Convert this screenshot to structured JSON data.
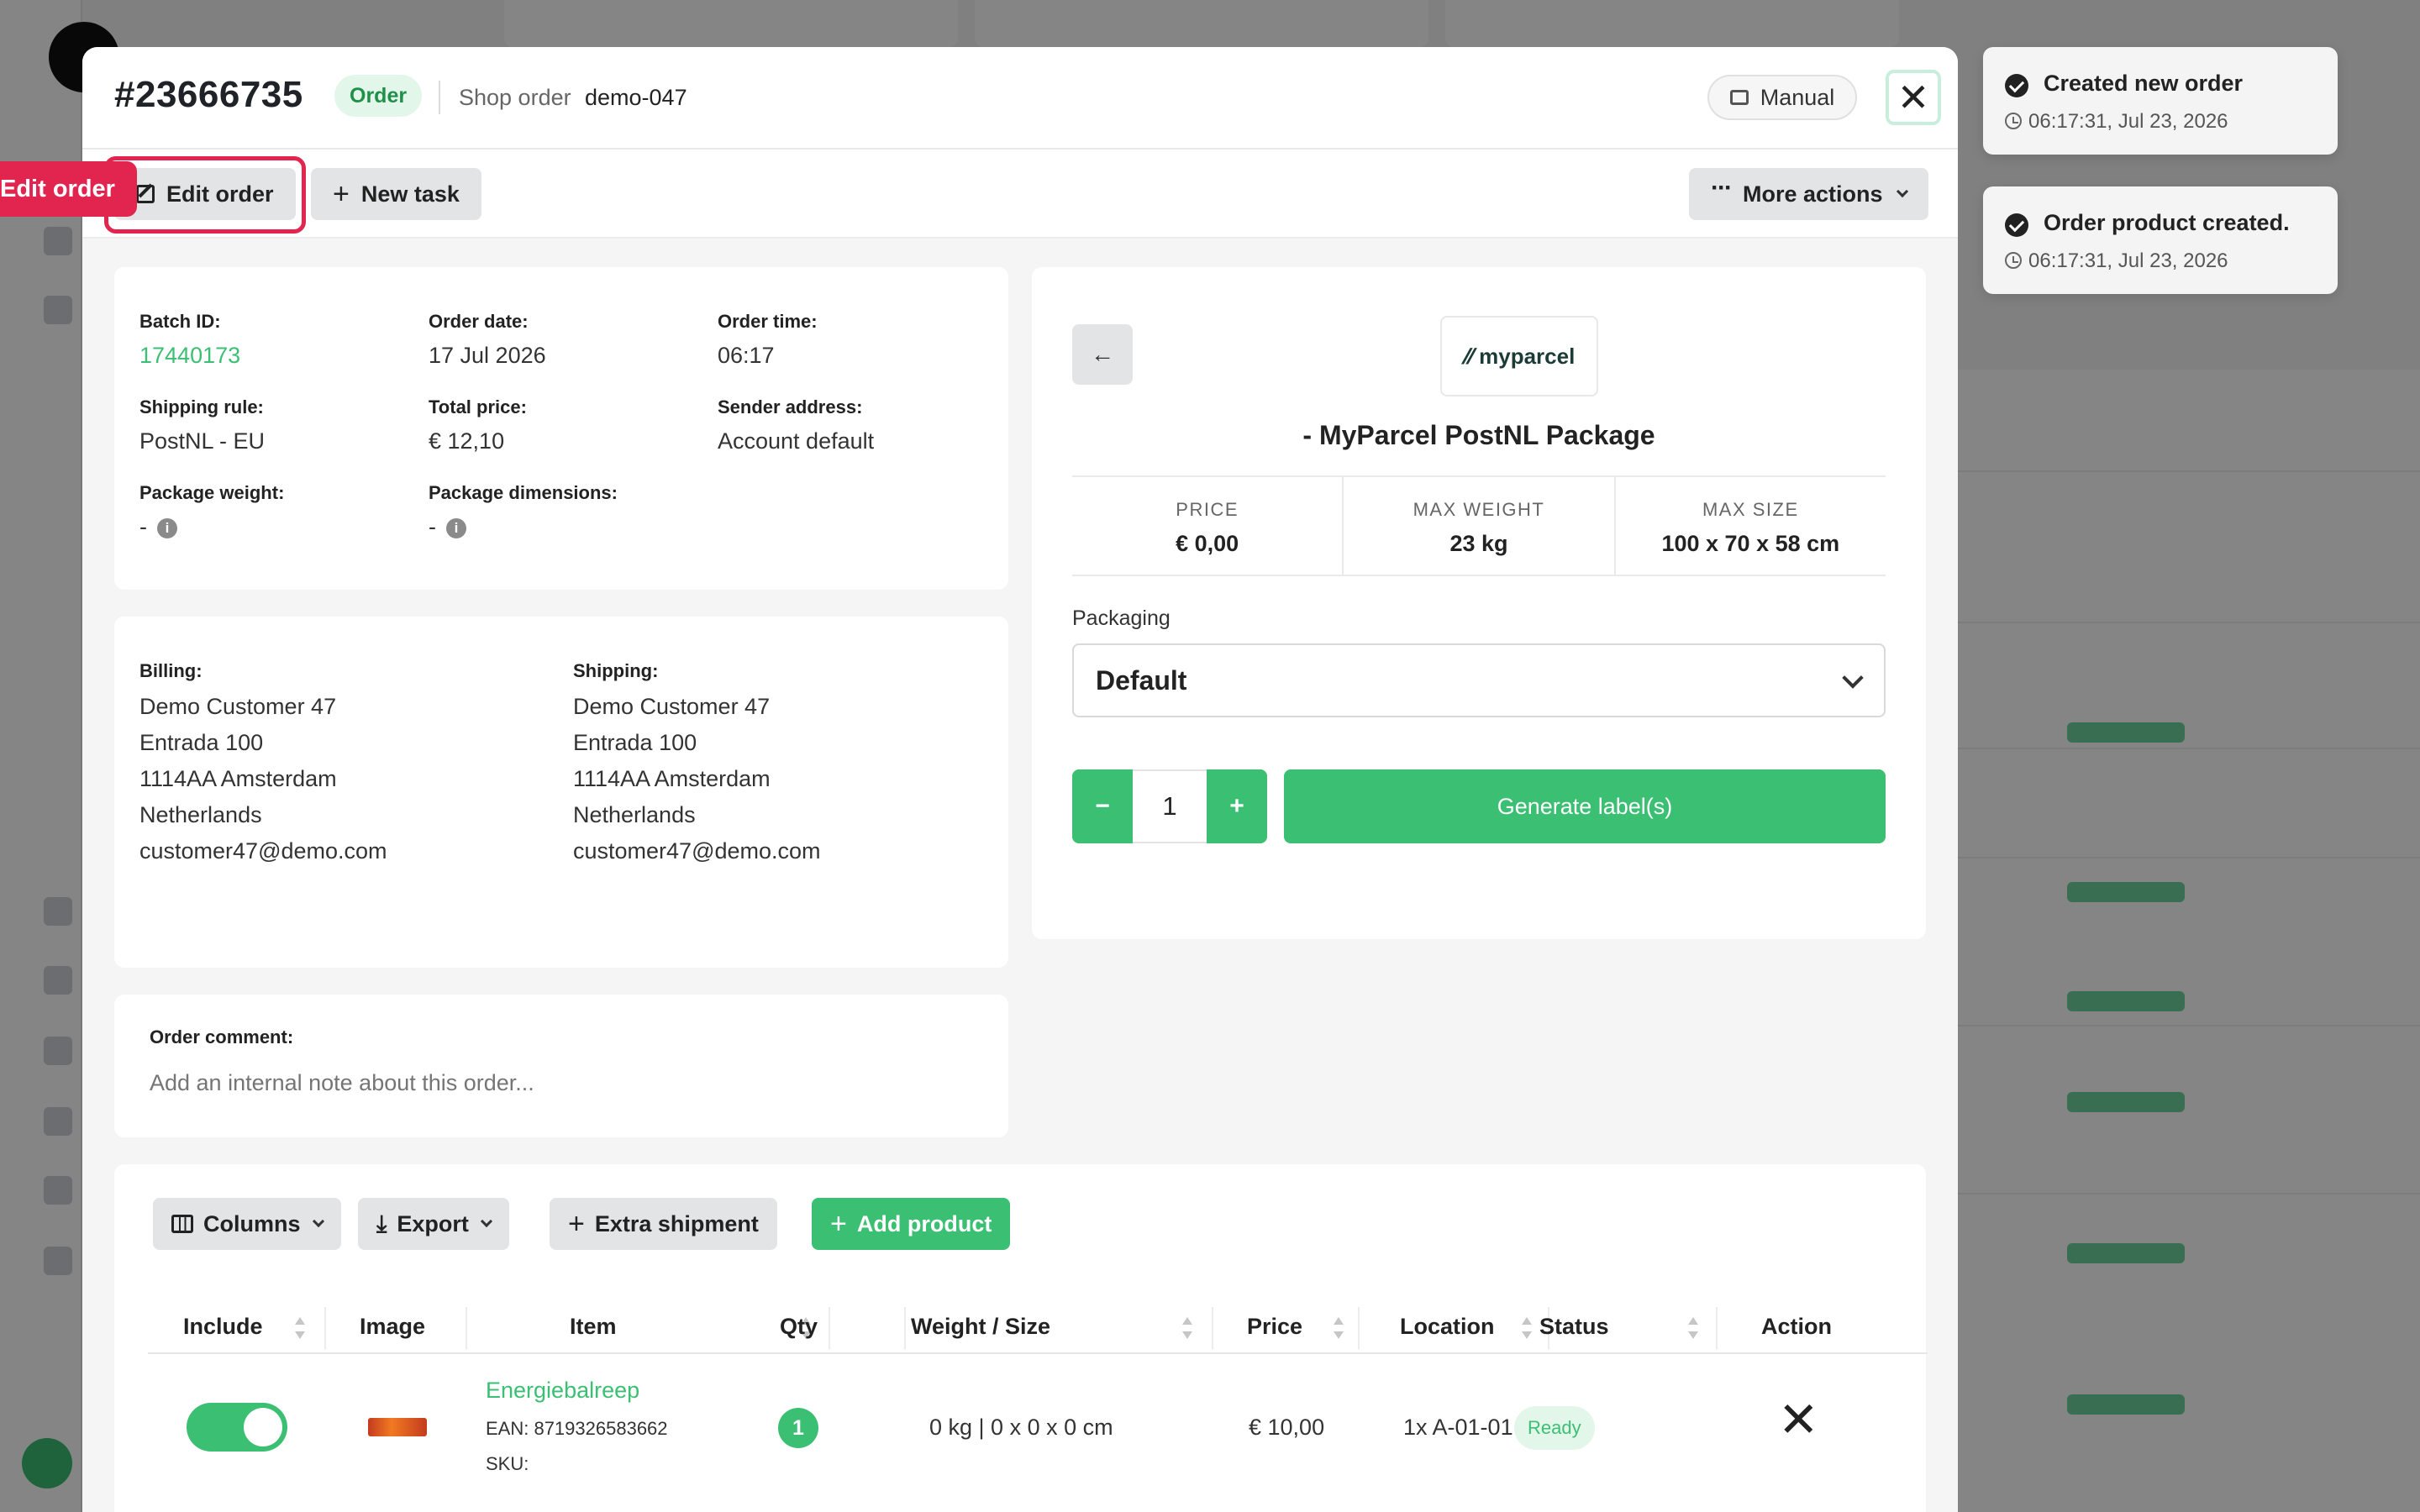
{
  "header": {
    "order_number": "#23666735",
    "type_badge": "Order",
    "shop_order_label": "Shop order",
    "shop_order_value": "demo-047",
    "source_label": "Manual",
    "close_label": "✕"
  },
  "toolbar": {
    "edit_label": "Edit order",
    "edit_tag": "Edit order",
    "new_task_label": "New task",
    "more_actions_label": "More actions"
  },
  "details": {
    "batch_id_label": "Batch ID:",
    "batch_id": "17440173",
    "order_date_label": "Order date:",
    "order_date": "17 Jul 2026",
    "order_time_label": "Order time:",
    "order_time": "06:17",
    "shipping_rule_label": "Shipping rule:",
    "shipping_rule": "PostNL - EU",
    "total_price_label": "Total price:",
    "total_price": "€ 12,10",
    "sender_address_label": "Sender address:",
    "sender_address": "Account default",
    "package_weight_label": "Package weight:",
    "package_weight": "-",
    "package_dimensions_label": "Package dimensions:",
    "package_dimensions": "-"
  },
  "billing": {
    "label": "Billing:",
    "name": "Demo Customer 47",
    "street": "Entrada 100",
    "city": "1114AA Amsterdam",
    "country": "Netherlands",
    "email": "customer47@demo.com"
  },
  "shipping": {
    "label": "Shipping:",
    "name": "Demo Customer 47",
    "street": "Entrada 100",
    "city": "1114AA Amsterdam",
    "country": "Netherlands",
    "email": "customer47@demo.com"
  },
  "comment": {
    "label": "Order comment:",
    "placeholder": "Add an internal note about this order..."
  },
  "carrier": {
    "logo_text": "myparcel",
    "title": "- MyParcel PostNL Package",
    "price_label": "PRICE",
    "price": "€ 0,00",
    "max_weight_label": "MAX WEIGHT",
    "max_weight": "23 kg",
    "max_size_label": "MAX SIZE",
    "max_size": "100 x 70 x 58 cm",
    "packaging_label": "Packaging",
    "packaging_value": "Default",
    "quantity": "1",
    "minus": "−",
    "plus": "+",
    "generate_label": "Generate label(s)"
  },
  "products": {
    "buttons": {
      "columns": "Columns",
      "export": "Export",
      "extra_shipment": "Extra shipment",
      "add_product": "Add product"
    },
    "columns": [
      "Include",
      "Image",
      "Item",
      "Qty",
      "Weight / Size",
      "Price",
      "Location",
      "Status",
      "Action"
    ],
    "rows": [
      {
        "name": "Energiebalreep",
        "ean": "EAN: 8719326583662",
        "sku": "SKU:",
        "qty": "1",
        "weight_size": "0 kg | 0 x 0 x 0 cm",
        "price": "€ 10,00",
        "location": "1x A-01-01",
        "status": "Ready",
        "include": true
      }
    ]
  },
  "toasts": [
    {
      "title": "Created new order",
      "time": "06:17:31, Jul 23, 2026"
    },
    {
      "title": "Order product created.",
      "time": "06:17:31, Jul 23, 2026"
    }
  ],
  "colors": {
    "accent": "#3bbf73",
    "highlight": "#e2254f"
  }
}
